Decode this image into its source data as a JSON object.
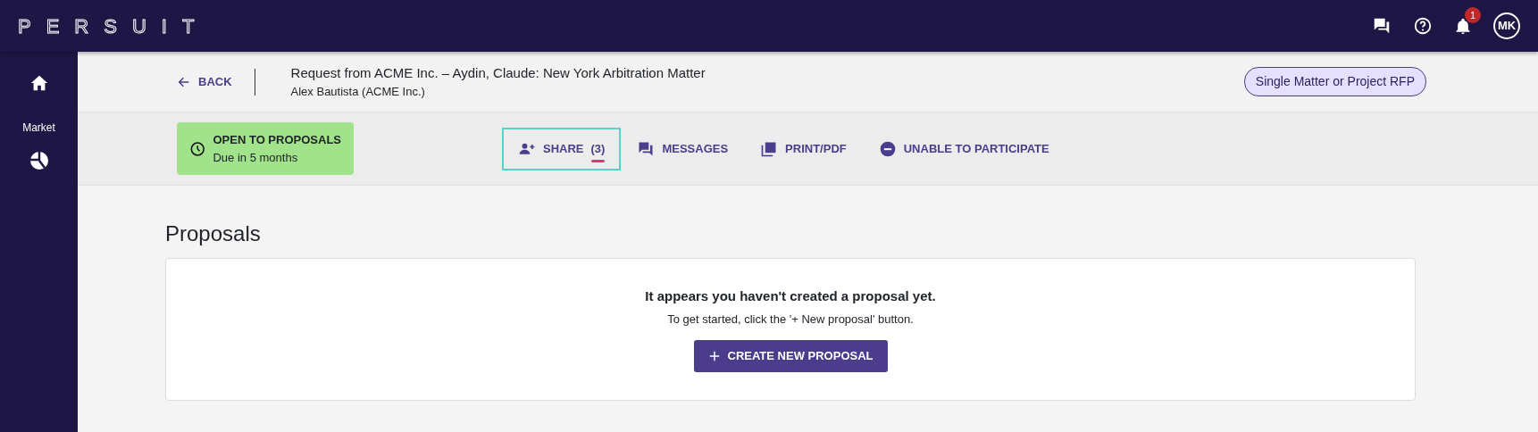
{
  "topbar": {
    "logo": "PERSUIT",
    "notifications_badge": "1",
    "avatar": "MK"
  },
  "sidebar": {
    "items": [
      {
        "kind": "home"
      },
      {
        "kind": "market",
        "label": "Market"
      }
    ]
  },
  "header": {
    "back": "BACK",
    "title": "Request from ACME Inc. – Aydin, Claude: New York Arbitration Matter",
    "subtitle": "Alex Bautista (ACME Inc.)",
    "tag": "Single Matter or Project RFP"
  },
  "status": {
    "title": "OPEN TO PROPOSALS",
    "due": "Due in 5 months"
  },
  "actions": [
    {
      "kind": "share",
      "label": "SHARE",
      "count": "(3)",
      "selected": true
    },
    {
      "kind": "messages",
      "label": "MESSAGES",
      "selected": false
    },
    {
      "kind": "print",
      "label": "PRINT/PDF",
      "selected": false
    },
    {
      "kind": "decline",
      "label": "UNABLE TO PARTICIPATE",
      "selected": false
    }
  ],
  "proposals": {
    "heading": "Proposals",
    "empty_title": "It appears you haven't created a proposal yet.",
    "empty_hint": "To get started, click the '+ New proposal' button.",
    "button": "CREATE NEW PROPOSAL"
  }
}
